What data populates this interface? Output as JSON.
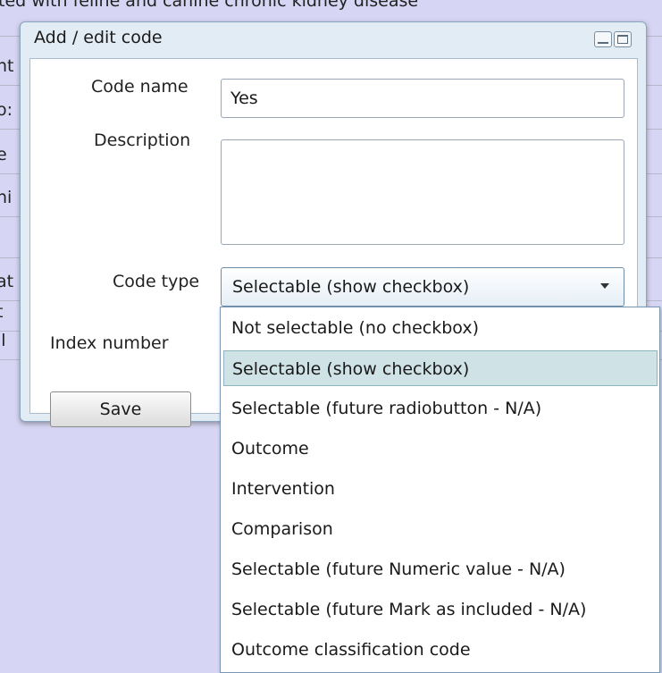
{
  "background": {
    "top_text": "ted with feline and canine chronic kidney disease",
    "row_fragments": [
      "nt",
      "o:",
      "e",
      "ni",
      "",
      "at",
      "t",
      "il"
    ]
  },
  "dialog": {
    "title": "Add / edit code",
    "labels": {
      "code_name": "Code name",
      "description": "Description",
      "code_type": "Code type",
      "index_number": "Index number"
    },
    "code_name_value": "Yes",
    "description_value": "",
    "code_type_selected": "Selectable (show checkbox)",
    "save_label": "Save"
  },
  "dropdown": {
    "options": [
      "Not selectable (no checkbox)",
      "Selectable (show checkbox)",
      "Selectable (future radiobutton - N/A)",
      "Outcome",
      "Intervention",
      "Comparison",
      "Selectable (future Numeric value - N/A)",
      "Selectable (future Mark as included - N/A)",
      "Outcome classification code"
    ],
    "selected_index": 1
  },
  "colors": {
    "background": "#d6d6f4",
    "selected_option": "#cfe2e5"
  },
  "icons": [
    "minimize-icon",
    "maximize-icon",
    "chevron-down-icon"
  ]
}
